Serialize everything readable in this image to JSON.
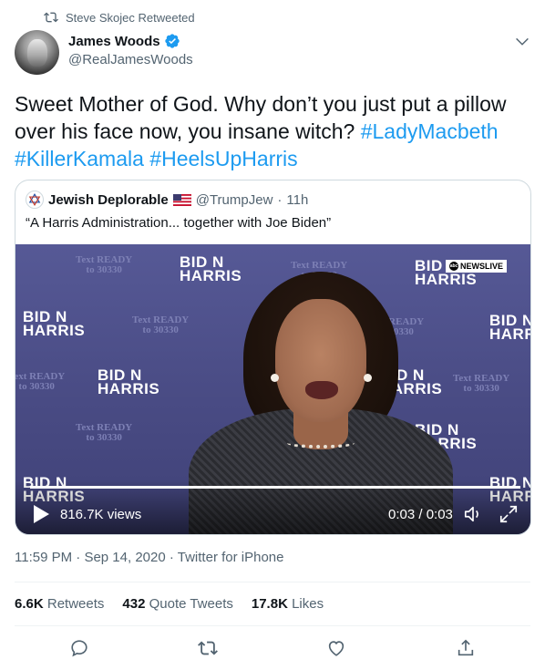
{
  "retweet": {
    "text": "Steve Skojec Retweeted",
    "icon": "retweet-icon"
  },
  "author": {
    "display_name": "James Woods",
    "handle": "@RealJamesWoods",
    "verified": true
  },
  "tweet": {
    "text_plain": "Sweet Mother of God. Why don’t you just put a pillow over his face now, you insane witch? ",
    "hashtags": [
      "#LadyMacbeth",
      "#KillerKamala",
      "#HeelsUpHarris"
    ]
  },
  "quote": {
    "display_name": "Jewish Deplorable",
    "handle": "@TrumpJew",
    "separator": "·",
    "age": "11h",
    "text": "“A Harris Administration... together with Joe Biden”",
    "flag_icon": "us-flag-icon"
  },
  "video": {
    "views": "816.7K views",
    "time": "0:03 / 0:03",
    "progress": 1.0,
    "logo_line1": "BID N",
    "logo_line2": "HARRIS",
    "ready_line1": "Text READY",
    "ready_line2": "to 30330",
    "news_badge": "NEWSLIVE",
    "news_badge_mark": "abc"
  },
  "meta": {
    "time": "11:59 PM",
    "separator": "·",
    "date": "Sep 14, 2020",
    "source": "Twitter for iPhone"
  },
  "stats": {
    "retweets_count": "6.6K",
    "retweets_label": "Retweets",
    "quotes_count": "432",
    "quotes_label": "Quote Tweets",
    "likes_count": "17.8K",
    "likes_label": "Likes"
  },
  "colors": {
    "link": "#1d9bf0",
    "secondary_text": "#536471",
    "primary_text": "#0f1419",
    "border": "#cfd9de"
  }
}
